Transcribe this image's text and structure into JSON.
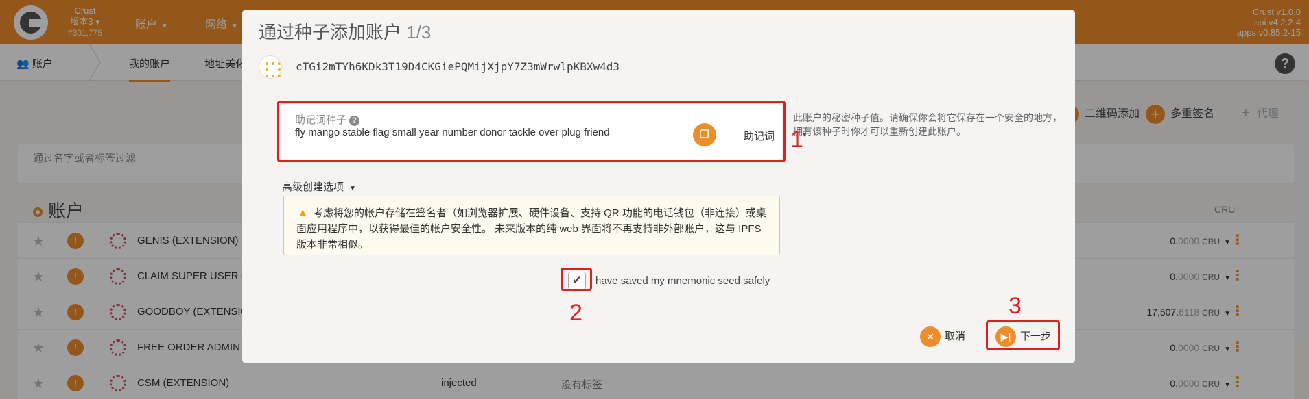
{
  "topbar": {
    "chain_name": "Crust",
    "chain_version": "版本3",
    "block_number": "#301,775",
    "nav": [
      "账户",
      "网络"
    ],
    "app_version": [
      "Crust v1.0.0",
      "api v4.2.2-4",
      "apps v0.85.2-15"
    ]
  },
  "subbar": {
    "section": "账户",
    "tabs": [
      "我的账户",
      "地址美化"
    ]
  },
  "toolbar": {
    "qr_add": "二维码添加",
    "multisig": "多重签名",
    "proxy": "代理"
  },
  "filter": {
    "placeholder": "通过名字或者标签过滤"
  },
  "accounts_section": {
    "title": "账户",
    "balance_header": "CRU"
  },
  "accounts": [
    {
      "name": "GENIS (EXTENSION)",
      "type": "",
      "tag": "",
      "balance_int": "0.",
      "balance_dec": "0000",
      "unit": "CRU"
    },
    {
      "name": "CLAIM SUPER USER (E",
      "type": "",
      "tag": "",
      "balance_int": "0.",
      "balance_dec": "0000",
      "unit": "CRU"
    },
    {
      "name": "GOODBOY (EXTENSIO",
      "type": "",
      "tag": "",
      "balance_int": "17,507.",
      "balance_dec": "6118",
      "unit": "CRU"
    },
    {
      "name": "FREE ORDER ADMIN (",
      "type": "",
      "tag": "",
      "balance_int": "0.",
      "balance_dec": "0000",
      "unit": "CRU"
    },
    {
      "name": "CSM (EXTENSION)",
      "type": "injected",
      "tag": "没有标签",
      "balance_int": "0.",
      "balance_dec": "0000",
      "unit": "CRU"
    }
  ],
  "modal": {
    "title": "通过种子添加账户",
    "step": "1/3",
    "address": "cTGi2mTYh6KDk3T19D4CKGiePQMijXjpY7Z3mWrwlpKBXw4d3",
    "seed_label": "助记词种子",
    "seed_value": "fly mango stable flag small year number donor tackle over plug friend",
    "seed_type": "助记词",
    "hint": "此账户的秘密种子值。请确保你会将它保存在一个安全的地方，拥有该种子时你才可以重新创建此账户。",
    "advanced": "高级创建选项",
    "warning": "考虑将您的帐户存储在签名者（如浏览器扩展、硬件设备、支持 QR 功能的电话钱包（非连接）或桌面应用程序中，以获得最佳的帐户安全性。 未来版本的纯 web 界面将不再支持非外部账户，这与 IPFS 版本非常相似。",
    "saved_label": "have saved my mnemonic seed safely",
    "cancel": "取消",
    "next": "下一步"
  },
  "annotations": [
    "1",
    "2",
    "3"
  ],
  "colors": {
    "accent": "#ee8d2c",
    "annotation": "#e02020"
  }
}
